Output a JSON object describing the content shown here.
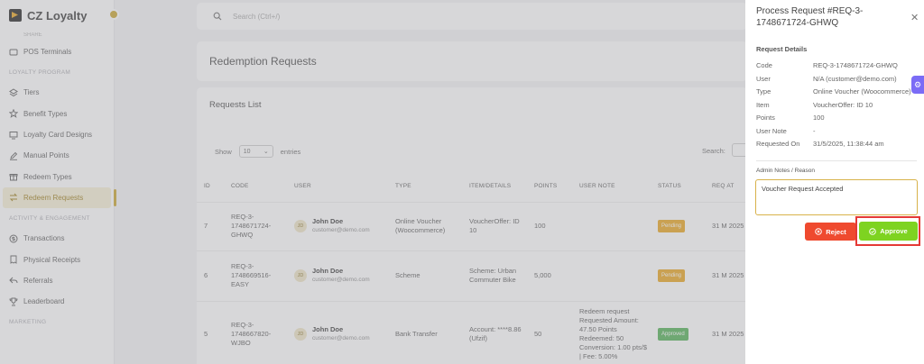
{
  "app": {
    "name": "CZ Loyalty"
  },
  "sidebar": {
    "cut_label": "SHARE",
    "items_top": [
      {
        "label": "POS Terminals",
        "icon": "terminal-icon"
      }
    ],
    "section_loyalty": "LOYALTY PROGRAM",
    "items_loyalty": [
      {
        "label": "Tiers",
        "icon": "layers-icon"
      },
      {
        "label": "Benefit Types",
        "icon": "star-icon"
      },
      {
        "label": "Loyalty Card Designs",
        "icon": "card-icon"
      },
      {
        "label": "Manual Points",
        "icon": "pencil-icon"
      },
      {
        "label": "Redeem Types",
        "icon": "gift-icon"
      },
      {
        "label": "Redeem Requests",
        "icon": "swap-icon"
      }
    ],
    "section_activity": "ACTIVITY & ENGAGEMENT",
    "items_activity": [
      {
        "label": "Transactions",
        "icon": "dollar-icon"
      },
      {
        "label": "Physical Receipts",
        "icon": "receipt-icon"
      },
      {
        "label": "Referrals",
        "icon": "share-icon"
      },
      {
        "label": "Leaderboard",
        "icon": "trophy-icon"
      }
    ],
    "section_marketing": "MARKETING"
  },
  "topbar": {
    "search_placeholder": "Search (Ctrl+/)"
  },
  "page": {
    "title": "Redemption Requests",
    "list_title": "Requests List"
  },
  "table_controls": {
    "show_label": "Show",
    "entries_value": "10",
    "entries_label": "entries",
    "search_label": "Search:"
  },
  "table": {
    "headers": [
      "ID",
      "CODE",
      "USER",
      "TYPE",
      "ITEM/DETAILS",
      "POINTS",
      "USER NOTE",
      "STATUS",
      "REQ AT"
    ],
    "rows": [
      {
        "id": "7",
        "code": "REQ-3-1748671724-GHWQ",
        "user_initials": "JD",
        "user_name": "John Doe",
        "user_email": "customer@demo.com",
        "type": "Online Voucher (Woocommerce)",
        "item": "VoucherOffer: ID 10",
        "points": "100",
        "note": "",
        "status": "Pending",
        "req_at": "31 M 2025"
      },
      {
        "id": "6",
        "code": "REQ-3-1748669516-EASY",
        "user_initials": "JD",
        "user_name": "John Doe",
        "user_email": "customer@demo.com",
        "type": "Scheme",
        "item": "Scheme: Urban Commuter Bike",
        "points": "5,000",
        "note": "",
        "status": "Pending",
        "req_at": "31 M 2025"
      },
      {
        "id": "5",
        "code": "REQ-3-1748667820-WJBO",
        "user_initials": "JD",
        "user_name": "John Doe",
        "user_email": "customer@demo.com",
        "type": "Bank Transfer",
        "item": "Account: ****8.86 (Ufzif)",
        "points": "50",
        "note": "Redeem request Requested Amount: 47.50 Points Redeemed: 50 Conversion: 1.00 pts/$ | Fee: 5.00%",
        "status": "Approved",
        "req_at": "31 M 2025"
      }
    ]
  },
  "panel": {
    "title": "Process Request #REQ-3-1748671724-GHWQ",
    "details_heading": "Request Details",
    "details": [
      {
        "k": "Code",
        "v": "REQ-3-1748671724-GHWQ"
      },
      {
        "k": "User",
        "v": "N/A (customer@demo.com)"
      },
      {
        "k": "Type",
        "v": "Online Voucher (Woocommerce)"
      },
      {
        "k": "Item",
        "v": "VoucherOffer: ID 10"
      },
      {
        "k": "Points",
        "v": "100"
      },
      {
        "k": "User Note",
        "v": "-"
      },
      {
        "k": "Requested On",
        "v": "31/5/2025, 11:38:44 am"
      }
    ],
    "notes_label": "Admin Notes / Reason",
    "notes_value": "Voucher Request Accepted",
    "reject_label": "Reject",
    "approve_label": "Approve"
  },
  "colors": {
    "accent": "#c9a227",
    "pending": "#e8a317",
    "approved": "#4caf50",
    "reject": "#ef4a2f",
    "approve": "#7ed321"
  }
}
